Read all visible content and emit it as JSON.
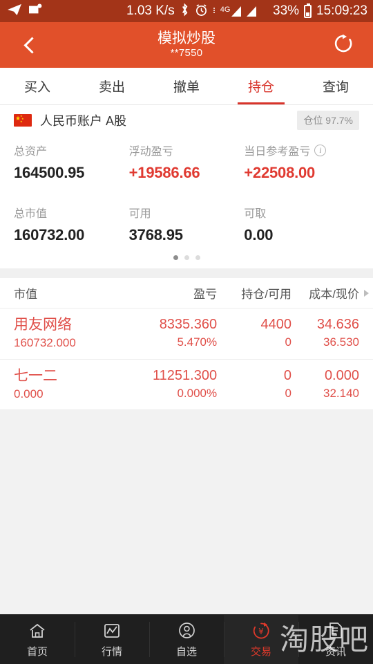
{
  "status_bar": {
    "net_speed": "1.03 K/s",
    "battery": "33%",
    "time": "15:09:23",
    "network_type": "4G",
    "icons": [
      "telegram-icon",
      "message-icon",
      "bluetooth-icon",
      "alarm-icon",
      "signal-icon",
      "signal-icon",
      "battery-icon"
    ]
  },
  "header": {
    "title": "模拟炒股",
    "subtitle": "**7550",
    "back_icon": "back-chevron-icon",
    "refresh_icon": "refresh-icon"
  },
  "tabs": [
    {
      "label": "买入",
      "active": false
    },
    {
      "label": "卖出",
      "active": false
    },
    {
      "label": "撤单",
      "active": false
    },
    {
      "label": "持仓",
      "active": true
    },
    {
      "label": "查询",
      "active": false
    }
  ],
  "account": {
    "flag_icon": "china-flag-icon",
    "name": "人民币账户 A股",
    "position_badge": "仓位 97.7%"
  },
  "summary": {
    "row1": [
      {
        "label": "总资产",
        "value": "164500.95",
        "positive": false,
        "info": false
      },
      {
        "label": "浮动盈亏",
        "value": "+19586.66",
        "positive": true,
        "info": false
      },
      {
        "label": "当日参考盈亏",
        "value": "+22508.00",
        "positive": true,
        "info": true
      }
    ],
    "row2": [
      {
        "label": "总市值",
        "value": "160732.00",
        "positive": false,
        "info": false
      },
      {
        "label": "可用",
        "value": "3768.95",
        "positive": false,
        "info": false
      },
      {
        "label": "可取",
        "value": "0.00",
        "positive": false,
        "info": false
      }
    ],
    "pager": {
      "total": 3,
      "active": 0
    }
  },
  "holdings": {
    "columns": [
      "市值",
      "盈亏",
      "持仓/可用",
      "成本/现价"
    ],
    "scroll_hint_icon": "chevron-right-icon",
    "rows": [
      {
        "name": "用友网络",
        "market_value": "160732.000",
        "profit": "8335.360",
        "profit_pct": "5.470%",
        "position": "4400",
        "available": "0",
        "cost": "34.636",
        "price": "36.530"
      },
      {
        "name": "七一二",
        "market_value": "0.000",
        "profit": "11251.300",
        "profit_pct": "0.000%",
        "position": "0",
        "available": "0",
        "cost": "0.000",
        "price": "32.140"
      }
    ]
  },
  "bottom_nav": [
    {
      "label": "首页",
      "icon": "home-icon",
      "active": false
    },
    {
      "label": "行情",
      "icon": "chart-icon",
      "active": false
    },
    {
      "label": "自选",
      "icon": "person-icon",
      "active": false
    },
    {
      "label": "交易",
      "icon": "yuan-trade-icon",
      "active": true
    },
    {
      "label": "资讯",
      "icon": "news-icon",
      "active": false
    }
  ],
  "watermark": "淘股吧",
  "colors": {
    "status_bar": "#a33418",
    "app_bar": "#e1502a",
    "accent_red": "#d8342b",
    "value_red": "#e0504a",
    "nav_bg": "#1f1f1f"
  }
}
